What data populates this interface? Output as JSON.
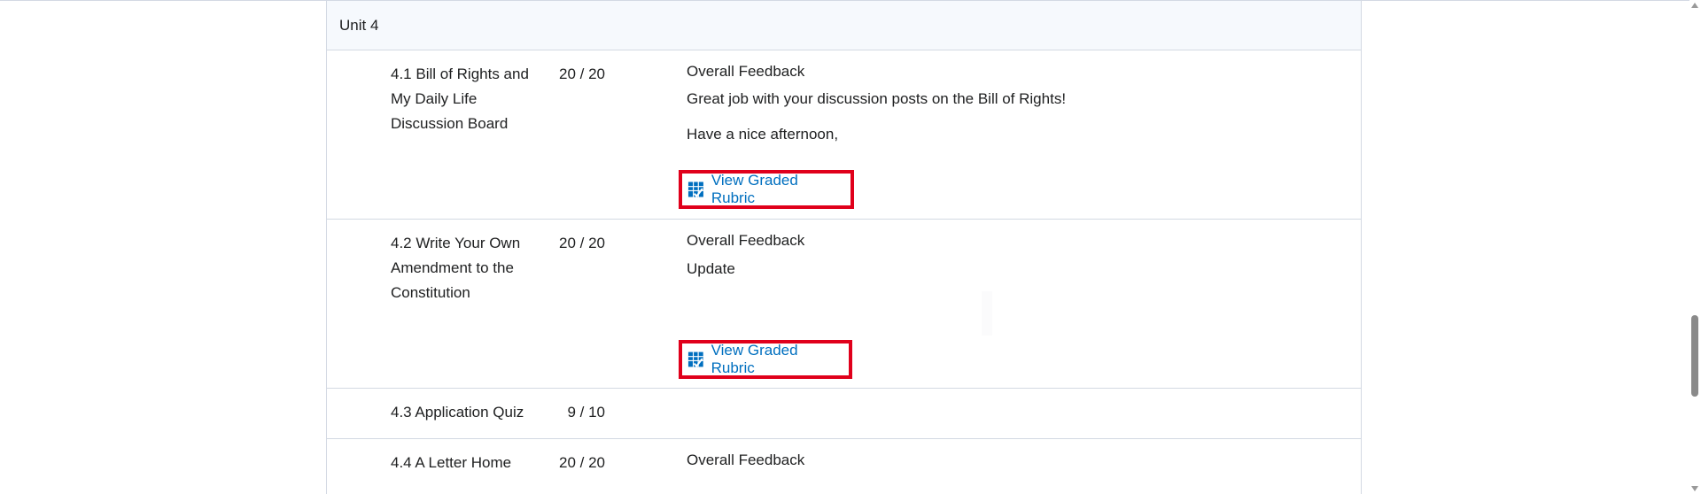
{
  "unit": {
    "title": "Unit 4"
  },
  "rows": [
    {
      "name": "4.1 Bill of Rights and My Daily Life Discussion Board",
      "score": "20 / 20",
      "feedback_heading": "Overall Feedback",
      "feedback_lines": [
        "Great job with your discussion posts on the Bill of Rights!",
        "Have a nice afternoon,"
      ],
      "rubric_label": "View Graded Rubric"
    },
    {
      "name": "4.2 Write Your Own Amendment to the Constitution",
      "score": "20 / 20",
      "feedback_heading": "Overall Feedback",
      "feedback_lines": [
        "Update"
      ],
      "rubric_label": "View Graded Rubric"
    },
    {
      "name": "4.3 Application Quiz",
      "score": "9 / 10"
    },
    {
      "name": "4.4 A Letter Home",
      "score": "20 / 20",
      "feedback_heading": "Overall Feedback"
    }
  ],
  "icons": {
    "rubric": "rubric-grid-icon"
  },
  "colors": {
    "link": "#006fbf",
    "highlight_border": "#e0001b",
    "header_bg": "#f6f9fd",
    "divider": "#d3d9e3"
  }
}
